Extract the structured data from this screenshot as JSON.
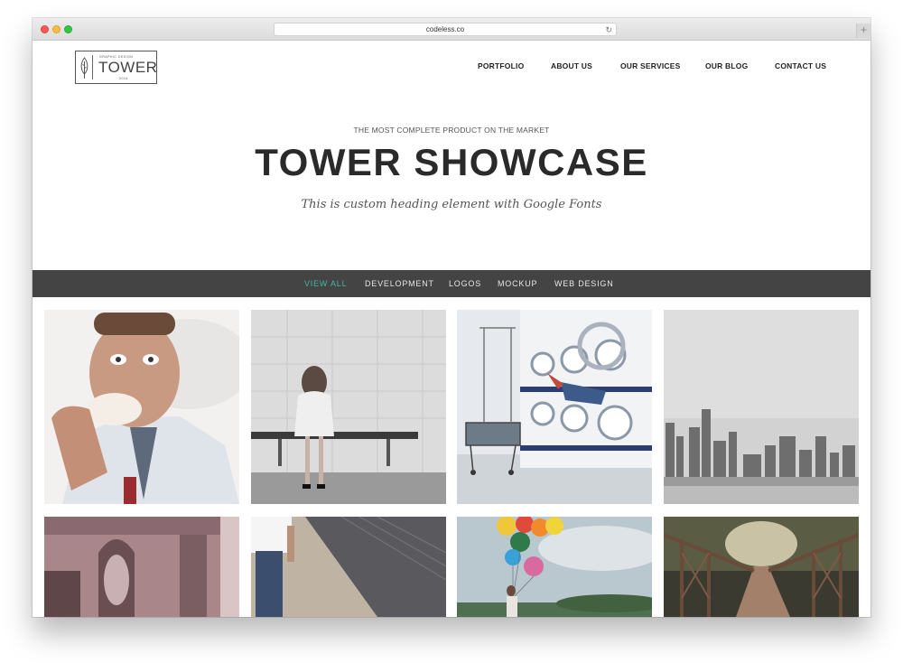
{
  "browser": {
    "url": "codeless.co",
    "new_tab_label": "+"
  },
  "logo": {
    "small_text": "GRAPHIC DESIGN",
    "name": "TOWER",
    "year": "2016"
  },
  "nav": {
    "items": [
      {
        "label": "PORTFOLIO"
      },
      {
        "label": "ABOUT US"
      },
      {
        "label": "OUR SERVICES"
      },
      {
        "label": "OUR BLOG"
      },
      {
        "label": "CONTACT US"
      }
    ]
  },
  "hero": {
    "kicker": "THE MOST COMPLETE PRODUCT ON THE MARKET",
    "title": "TOWER SHOWCASE",
    "subtitle": "This is custom heading element with Google Fonts"
  },
  "filters": {
    "active": "VIEW ALL",
    "items": [
      {
        "label": "VIEW ALL"
      },
      {
        "label": "DEVELOPMENT"
      },
      {
        "label": "LOGOS"
      },
      {
        "label": "MOCKUP"
      },
      {
        "label": "WEB DESIGN"
      }
    ]
  },
  "colors": {
    "accent": "#3fb8a5",
    "filter_bar": "#444444",
    "text_dark": "#2a2a2a"
  }
}
